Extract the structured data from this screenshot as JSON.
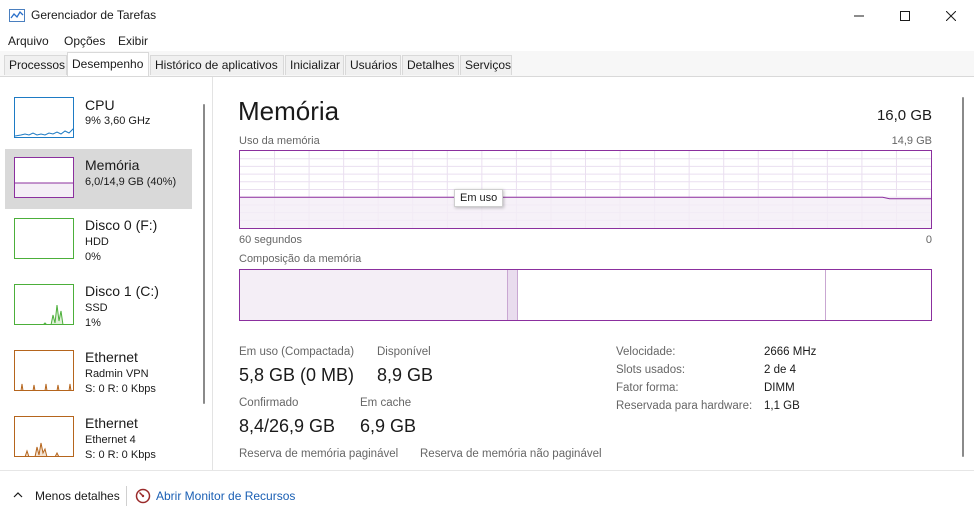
{
  "window": {
    "title": "Gerenciador de Tarefas"
  },
  "menu": [
    "Arquivo",
    "Opções",
    "Exibir"
  ],
  "tabs": [
    {
      "label": "Processos",
      "active": false
    },
    {
      "label": "Desempenho",
      "active": true
    },
    {
      "label": "Histórico de aplicativos",
      "active": false
    },
    {
      "label": "Inicializar",
      "active": false
    },
    {
      "label": "Usuários",
      "active": false
    },
    {
      "label": "Detalhes",
      "active": false
    },
    {
      "label": "Serviços",
      "active": false
    }
  ],
  "sidebar": [
    {
      "title": "CPU",
      "lines": [
        "9% 3,60 GHz"
      ],
      "color": "#1e7bc4",
      "selected": false
    },
    {
      "title": "Memória",
      "lines": [
        "6,0/14,9 GB (40%)"
      ],
      "color": "#8b2f9e",
      "selected": true
    },
    {
      "title": "Disco 0 (F:)",
      "lines": [
        "HDD",
        "0%"
      ],
      "color": "#4caf3a",
      "selected": false
    },
    {
      "title": "Disco 1 (C:)",
      "lines": [
        "SSD",
        "1%"
      ],
      "color": "#4caf3a",
      "selected": false
    },
    {
      "title": "Ethernet",
      "lines": [
        "Radmin VPN",
        "S: 0 R: 0 Kbps"
      ],
      "color": "#b5651d",
      "selected": false
    },
    {
      "title": "Ethernet",
      "lines": [
        "Ethernet 4",
        "S: 0 R: 0 Kbps"
      ],
      "color": "#b5651d",
      "selected": false
    }
  ],
  "main": {
    "title": "Memória",
    "total": "16,0 GB",
    "usage_label": "Uso da memória",
    "usage_max": "14,9 GB",
    "time_span": "60 segundos",
    "time_end": "0",
    "tooltip": "Em uso",
    "composition_label": "Composição da memória",
    "usage_fraction": 0.4,
    "composition": {
      "in_use": 0.387,
      "modified": 0.016,
      "standby": 0.446,
      "free": 0.151
    },
    "stats": [
      {
        "label": "Em uso (Compactada)",
        "value": "5,8 GB (0 MB)"
      },
      {
        "label": "Disponível",
        "value": "8,9 GB"
      },
      {
        "label": "Confirmado",
        "value": "8,4/26,9 GB"
      },
      {
        "label": "Em cache",
        "value": "6,9 GB"
      },
      {
        "label": "Reserva de memória paginável",
        "value": ""
      },
      {
        "label": "Reserva de memória não paginável",
        "value": ""
      }
    ],
    "specs": [
      {
        "label": "Velocidade:",
        "value": "2666 MHz"
      },
      {
        "label": "Slots usados:",
        "value": "2 de 4"
      },
      {
        "label": "Fator forma:",
        "value": "DIMM"
      },
      {
        "label": "Reservada para hardware:",
        "value": "1,1 GB"
      }
    ]
  },
  "footer": {
    "less_details": "Menos detalhes",
    "resource_monitor": "Abrir Monitor de Recursos"
  },
  "colors": {
    "memory": "#8b2f9e",
    "memory_fill": "#f4eef6",
    "link": "#1a5fb4"
  }
}
